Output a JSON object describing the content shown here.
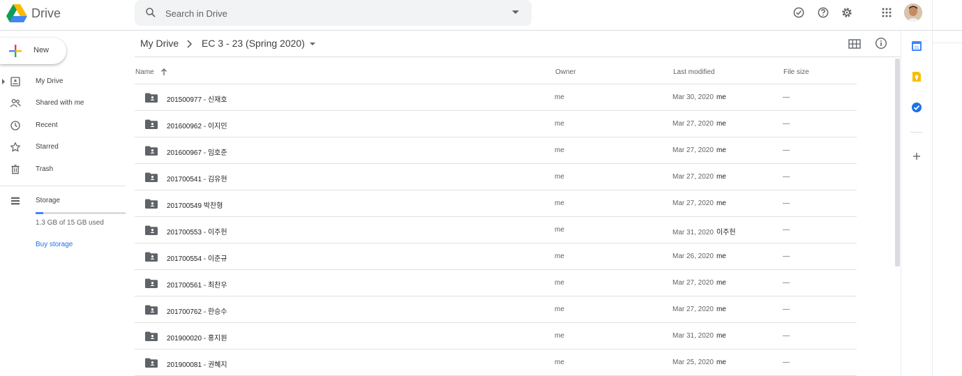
{
  "header": {
    "product_name": "Drive",
    "search_placeholder": "Search in Drive",
    "icons": [
      "offline-ready-icon",
      "help-icon",
      "settings-icon",
      "apps-grid-icon"
    ]
  },
  "sidebar": {
    "new_label": "New",
    "items": [
      {
        "label": "My Drive",
        "icon": "my-drive-icon"
      },
      {
        "label": "Shared with me",
        "icon": "shared-icon"
      },
      {
        "label": "Recent",
        "icon": "clock-icon"
      },
      {
        "label": "Starred",
        "icon": "star-icon"
      },
      {
        "label": "Trash",
        "icon": "trash-icon"
      }
    ],
    "storage": {
      "label": "Storage",
      "used_text": "1.3 GB of 15 GB used",
      "used_fraction": 0.087,
      "buy_label": "Buy storage"
    }
  },
  "breadcrumb": {
    "root": "My Drive",
    "current": "EC 3 - 23 (Spring 2020)"
  },
  "table": {
    "columns": {
      "name": "Name",
      "owner": "Owner",
      "modified": "Last modified",
      "size": "File size"
    },
    "rows": [
      {
        "name": "201500977 - 신재호",
        "owner": "me",
        "date": "Mar 30, 2020",
        "by": "me",
        "size": "—"
      },
      {
        "name": "201600962 - 이지민",
        "owner": "me",
        "date": "Mar 27, 2020",
        "by": "me",
        "size": "—"
      },
      {
        "name": "201600967 - 임호준",
        "owner": "me",
        "date": "Mar 27, 2020",
        "by": "me",
        "size": "—"
      },
      {
        "name": "201700541 - 김유현",
        "owner": "me",
        "date": "Mar 27, 2020",
        "by": "me",
        "size": "—"
      },
      {
        "name": "201700549 박찬형",
        "owner": "me",
        "date": "Mar 27, 2020",
        "by": "me",
        "size": "—"
      },
      {
        "name": "201700553 - 이주헌",
        "owner": "me",
        "date": "Mar 31, 2020",
        "by": "이주헌",
        "size": "—"
      },
      {
        "name": "201700554 - 이준규",
        "owner": "me",
        "date": "Mar 26, 2020",
        "by": "me",
        "size": "—"
      },
      {
        "name": "201700561 - 최찬우",
        "owner": "me",
        "date": "Mar 27, 2020",
        "by": "me",
        "size": "—"
      },
      {
        "name": "201700762 - 한승수",
        "owner": "me",
        "date": "Mar 27, 2020",
        "by": "me",
        "size": "—"
      },
      {
        "name": "201900020 - 홍지원",
        "owner": "me",
        "date": "Mar 31, 2020",
        "by": "me",
        "size": "—"
      },
      {
        "name": "201900081 - 권혜지",
        "owner": "me",
        "date": "Mar 25, 2020",
        "by": "me",
        "size": "—"
      }
    ]
  },
  "side_panel": {
    "calendar_text": "31",
    "icons": [
      "calendar-icon",
      "keep-icon",
      "tasks-icon",
      "add-addon-icon"
    ]
  },
  "colors": {
    "accent": "#1a73e8",
    "storage_fill": "#4285f4",
    "folder": "#5f6368"
  }
}
